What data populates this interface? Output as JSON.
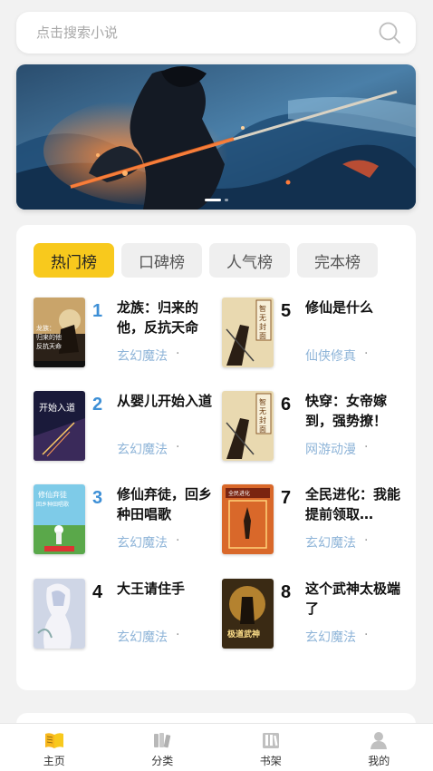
{
  "search": {
    "placeholder": "点击搜索小说"
  },
  "banner": {
    "slides": 2,
    "active": 1
  },
  "tabs": [
    {
      "label": "热门榜",
      "active": true
    },
    {
      "label": "口碑榜",
      "active": false
    },
    {
      "label": "人气榜",
      "active": false
    },
    {
      "label": "完本榜",
      "active": false
    }
  ],
  "books": [
    {
      "rank": "1",
      "title": "龙族：归来的他，反抗天命",
      "genre": "玄幻魔法",
      "rank_color": "#3d8fd6",
      "cover_text": "龙族：归来的他，反抗天命"
    },
    {
      "rank": "2",
      "title": "从婴儿开始入道",
      "genre": "玄幻魔法",
      "rank_color": "#3d8fd6",
      "cover_text": "开始入道"
    },
    {
      "rank": "3",
      "title": "修仙弃徒，回乡种田唱歌",
      "genre": "玄幻魔法",
      "rank_color": "#3d8fd6",
      "cover_text": "修仙弃徒 回乡种田唱歌"
    },
    {
      "rank": "4",
      "title": "大王请住手",
      "genre": "玄幻魔法",
      "rank_color": "#111111",
      "cover_text": ""
    },
    {
      "rank": "5",
      "title": "修仙是什么",
      "genre": "仙侠修真",
      "rank_color": "#111111",
      "cover_text": "智无封面"
    },
    {
      "rank": "6",
      "title": "快穿：女帝嫁到，强势撩！",
      "genre": "网游动漫",
      "rank_color": "#111111",
      "cover_text": "智无封面"
    },
    {
      "rank": "7",
      "title": "全民进化：我能提前领取…",
      "genre": "玄幻魔法",
      "rank_color": "#111111",
      "cover_text": "全民进化"
    },
    {
      "rank": "8",
      "title": "这个武神太极端了",
      "genre": "玄幻魔法",
      "rank_color": "#111111",
      "cover_text": "极道武神"
    }
  ],
  "genre_separator": "·",
  "nav": [
    {
      "label": "主页",
      "icon": "book-open-icon",
      "active": true
    },
    {
      "label": "分类",
      "icon": "books-icon",
      "active": false
    },
    {
      "label": "书架",
      "icon": "bookshelf-icon",
      "active": false
    },
    {
      "label": "我的",
      "icon": "user-icon",
      "active": false
    }
  ],
  "colors": {
    "accent": "#f8c91d",
    "genre": "#8eb4d8",
    "rank_top": "#3d8fd6"
  }
}
